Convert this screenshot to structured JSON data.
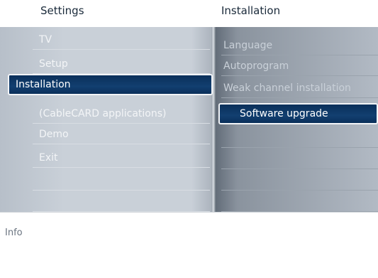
{
  "header": {
    "left_title": "Settings",
    "right_title": "Installation"
  },
  "menu": {
    "items": [
      {
        "label": "TV"
      },
      {
        "label": "Setup"
      },
      {
        "label": "Installation"
      },
      {
        "label": "(CableCARD applications)"
      },
      {
        "label": "Demo"
      },
      {
        "label": "Exit"
      },
      {
        "label": ""
      },
      {
        "label": ""
      }
    ],
    "selected_index": 2
  },
  "submenu": {
    "items": [
      {
        "label": "Language"
      },
      {
        "label": "Autoprogram"
      },
      {
        "label": "Weak channel installation"
      },
      {
        "label": "Software upgrade"
      },
      {
        "label": ""
      },
      {
        "label": ""
      },
      {
        "label": ""
      },
      {
        "label": ""
      }
    ],
    "selected_index": 3
  },
  "info": {
    "label": "Info"
  },
  "colors": {
    "selection_bg": "#123f70",
    "menu_bg": "#c9d0d8",
    "submenu_bg": "#8a939e"
  }
}
